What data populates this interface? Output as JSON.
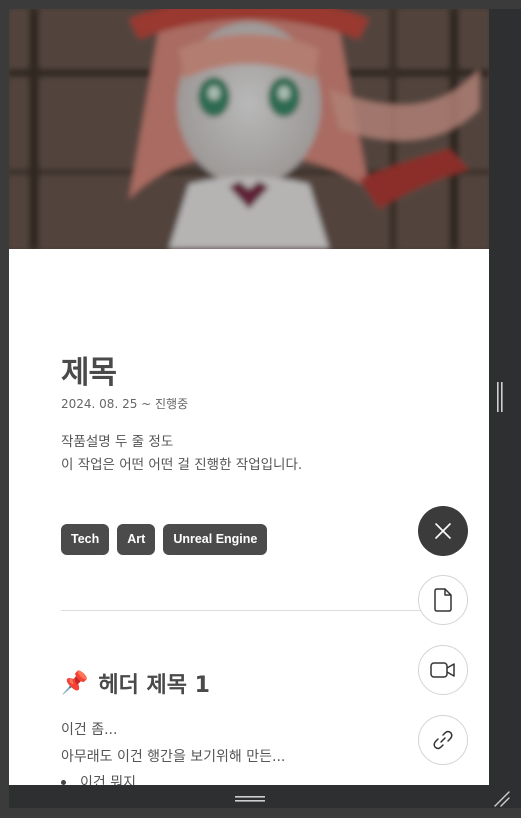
{
  "page": {
    "title": "제목",
    "date": "2024. 08. 25 ~ 진행중",
    "description": [
      "작품설명 두 줄 정도",
      "이 작업은 어떤 어떤 걸 진행한 작업입니다."
    ],
    "tags": [
      "Tech",
      "Art",
      "Unreal Engine"
    ],
    "heading1": {
      "emoji": "📌",
      "text": "헤더 제목 1"
    },
    "paragraphs": [
      "이건 좀...",
      "아무래도 이건 행간을 보기위해 만든..."
    ],
    "bullets": [
      "이건 뭐지"
    ]
  },
  "fab": {
    "close": "close-icon",
    "document": "document-icon",
    "video": "video-icon",
    "link": "link-icon"
  },
  "colors": {
    "accent": "#3b3b3b",
    "tag_bg": "#4b4b4b",
    "frame": "#2e2f31"
  }
}
